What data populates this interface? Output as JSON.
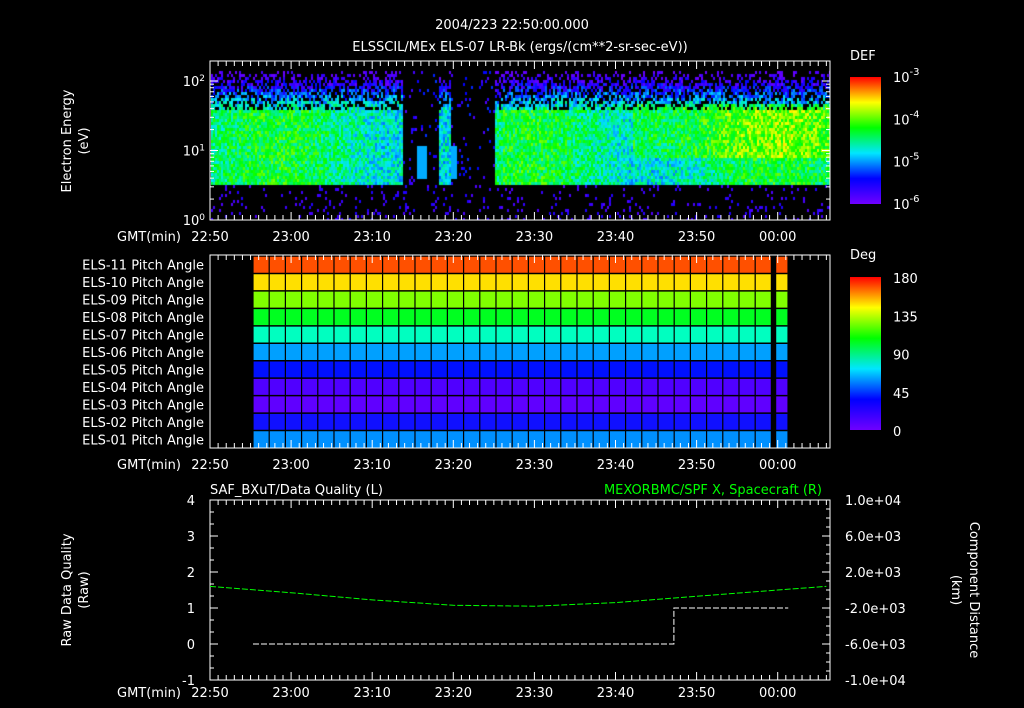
{
  "header": {
    "datetime": "2004/223 22:50:00.000"
  },
  "chart_data": [
    {
      "type": "heatmap",
      "title": "ELSSCIL/MEx ELS-07 LR-Bk  (ergs/(cm**2-sr-sec-eV))",
      "xlabel": "GMT(min)",
      "ylabel": "Electron Energy (eV)",
      "x_ticks": [
        "22:50",
        "23:00",
        "23:10",
        "23:20",
        "23:30",
        "23:40",
        "23:50",
        "00:00"
      ],
      "x_range_min": [
        0,
        76
      ],
      "y_scale": "log",
      "y_ticks": [
        "10^0",
        "10^1",
        "10^2"
      ],
      "y_range": [
        1,
        180
      ],
      "colorbar": {
        "label": "DEF",
        "ticks": [
          "10^-3",
          "10^-4",
          "10^-5",
          "10^-6"
        ],
        "range": [
          1e-06,
          0.001
        ]
      },
      "data_gaps_min": [
        [
          23.5,
          28
        ],
        [
          29.5,
          35
        ]
      ],
      "band_energy_eV": [
        3.5,
        150
      ]
    },
    {
      "type": "heatmap",
      "xlabel": "GMT(min)",
      "x_ticks": [
        "22:50",
        "23:00",
        "23:10",
        "23:20",
        "23:30",
        "23:40",
        "23:50",
        "00:00"
      ],
      "rows": [
        "ELS-11 Pitch Angle",
        "ELS-10 Pitch Angle",
        "ELS-09 Pitch Angle",
        "ELS-08 Pitch Angle",
        "ELS-07 Pitch Angle",
        "ELS-06 Pitch Angle",
        "ELS-05 Pitch Angle",
        "ELS-04 Pitch Angle",
        "ELS-03 Pitch Angle",
        "ELS-02 Pitch Angle",
        "ELS-01 Pitch Angle"
      ],
      "row_values_deg": [
        170,
        130,
        110,
        95,
        80,
        60,
        35,
        15,
        10,
        25,
        50
      ],
      "row_colors": [
        "#ff5000",
        "#ffe000",
        "#80ff00",
        "#00ff20",
        "#00ffc0",
        "#00a0ff",
        "#0010ff",
        "#5000ff",
        "#6000ff",
        "#1010ff",
        "#0090ff"
      ],
      "data_start_min": 5.3,
      "data_end_min": 71.2,
      "colorbar": {
        "label": "Deg",
        "ticks": [
          "180",
          "135",
          "90",
          "45",
          "0"
        ],
        "range": [
          0,
          180
        ]
      }
    },
    {
      "type": "line",
      "title_left": "SAF_BXuT/Data Quality (L)",
      "title_right": "MEXORBMC/SPF X, Spacecraft (R)",
      "xlabel": "GMT(min)",
      "x_ticks": [
        "22:50",
        "23:00",
        "23:10",
        "23:20",
        "23:30",
        "23:40",
        "23:50",
        "00:00"
      ],
      "ylabel_left": "Raw Data Quality (Raw)",
      "ylabel_right": "Component Distance (km)",
      "yticks_left": [
        "4",
        "3",
        "2",
        "1",
        "0",
        "-1"
      ],
      "ylim_left": [
        -1,
        4
      ],
      "yticks_right": [
        "1.0e+04",
        "6.0e+03",
        "2.0e+03",
        "-2.0e+03",
        "-6.0e+03",
        "-1.0e+04"
      ],
      "ylim_right": [
        -10000,
        10000
      ],
      "series": [
        {
          "name": "Data Quality",
          "axis": "left",
          "color": "#ffffff",
          "x_min": [
            5.3,
            57.2,
            57.2,
            71.3
          ],
          "y": [
            0,
            0,
            1,
            1
          ]
        },
        {
          "name": "SPF X",
          "axis": "right",
          "color": "#00ff00",
          "x_min": [
            0,
            10,
            20,
            30,
            40,
            50,
            60,
            70,
            76
          ],
          "y": [
            400,
            -300,
            -1100,
            -1700,
            -1800,
            -1400,
            -700,
            0,
            400
          ]
        }
      ]
    }
  ]
}
